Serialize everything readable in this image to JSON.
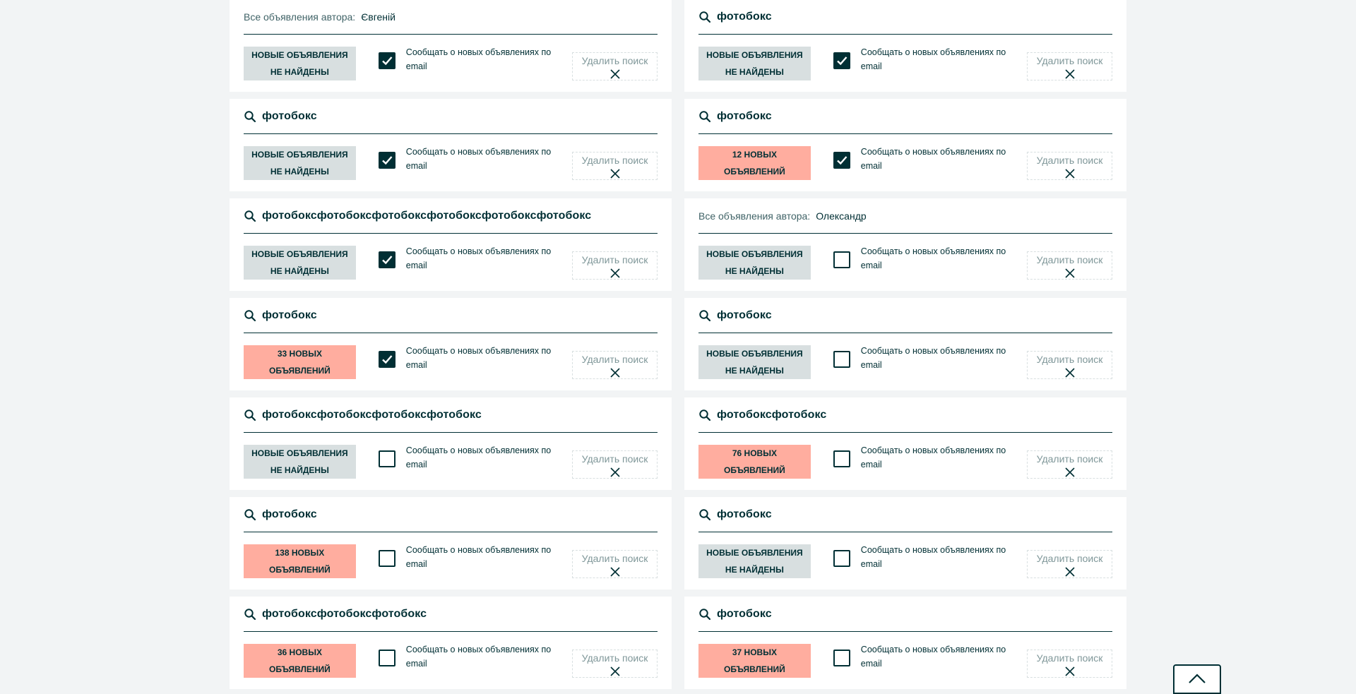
{
  "texts": {
    "author_label": "Все объявления автора:",
    "notify_label": "Сообщать о новых объявлениях по email",
    "delete_label": "Удалить поиск"
  },
  "colors": {
    "primary": "#002f34",
    "status_none_bg": "#d8dfe0",
    "status_new_bg": "#ffad9f",
    "page_bg": "#f2f4f5"
  },
  "icons": {
    "search": "search-icon",
    "check": "checkmark-icon",
    "delete": "close-icon",
    "scroll_top": "chevron-up-icon"
  },
  "cards": [
    {
      "type": "author",
      "author": "Євгеній",
      "status": "none",
      "status_text": "Новые объявления не найдены",
      "notify": true
    },
    {
      "type": "query",
      "query": "фотобокс",
      "status": "none",
      "status_text": "Новые объявления не найдены",
      "notify": true
    },
    {
      "type": "query",
      "query": "фотобокс",
      "status": "none",
      "status_text": "Новые объявления не найдены",
      "notify": true
    },
    {
      "type": "query",
      "query": "фотобокс",
      "status": "new",
      "status_text": "12 новых объявлений",
      "notify": true
    },
    {
      "type": "query",
      "query": "фотобоксфотобоксфотобоксфотобоксфотобоксфотобокс",
      "status": "none",
      "status_text": "Новые объявления не найдены",
      "notify": true
    },
    {
      "type": "author",
      "author": "Олександр",
      "status": "none",
      "status_text": "Новые объявления не найдены",
      "notify": false
    },
    {
      "type": "query",
      "query": "фотобокс",
      "status": "new",
      "status_text": "33 новых объявлений",
      "notify": true
    },
    {
      "type": "query",
      "query": "фотобокс",
      "status": "none",
      "status_text": "Новые объявления не найдены",
      "notify": false
    },
    {
      "type": "query",
      "query": "фотобоксфотобоксфотобоксфотобокс",
      "status": "none",
      "status_text": "Новые объявления не найдены",
      "notify": false
    },
    {
      "type": "query",
      "query": "фотобоксфотобокс",
      "status": "new",
      "status_text": "76 новых объявлений",
      "notify": false
    },
    {
      "type": "query",
      "query": "фотобокс",
      "status": "new",
      "status_text": "138 новых объявлений",
      "notify": false
    },
    {
      "type": "query",
      "query": "фотобокс",
      "status": "none",
      "status_text": "Новые объявления не найдены",
      "notify": false
    },
    {
      "type": "query",
      "query": "фотобоксфотобоксфотобокс",
      "status": "new",
      "status_text": "36 новых объявлений",
      "notify": false
    },
    {
      "type": "query",
      "query": "фотобокс",
      "status": "new",
      "status_text": "37 новых объявлений",
      "notify": false
    }
  ]
}
